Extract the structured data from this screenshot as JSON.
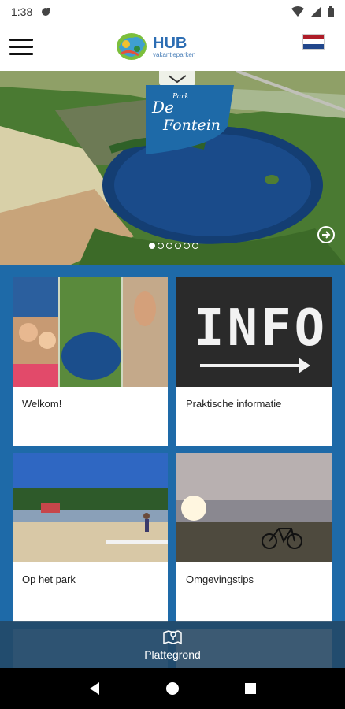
{
  "status": {
    "time": "1:38"
  },
  "header": {
    "logo_main": "HUB",
    "logo_sub": "vakantieparken",
    "language": "Nederlands"
  },
  "hero": {
    "badge_small": "Park",
    "badge_title_line1": "De",
    "badge_title_line2": "Fontein",
    "slide_count": 6,
    "active_slide": 1
  },
  "cards": [
    {
      "label": "Welkom!"
    },
    {
      "label": "Praktische informatie"
    },
    {
      "label": "Op het park"
    },
    {
      "label": "Omgevingstips"
    }
  ],
  "info_sign_text": "INFO",
  "bottom_bar": {
    "label": "Plattegrond",
    "icon": "map-icon"
  },
  "colors": {
    "brand_blue": "#1e6aa8",
    "logo_blue": "#2c6db3",
    "flag_red": "#ae1c28",
    "flag_blue": "#21468b"
  }
}
